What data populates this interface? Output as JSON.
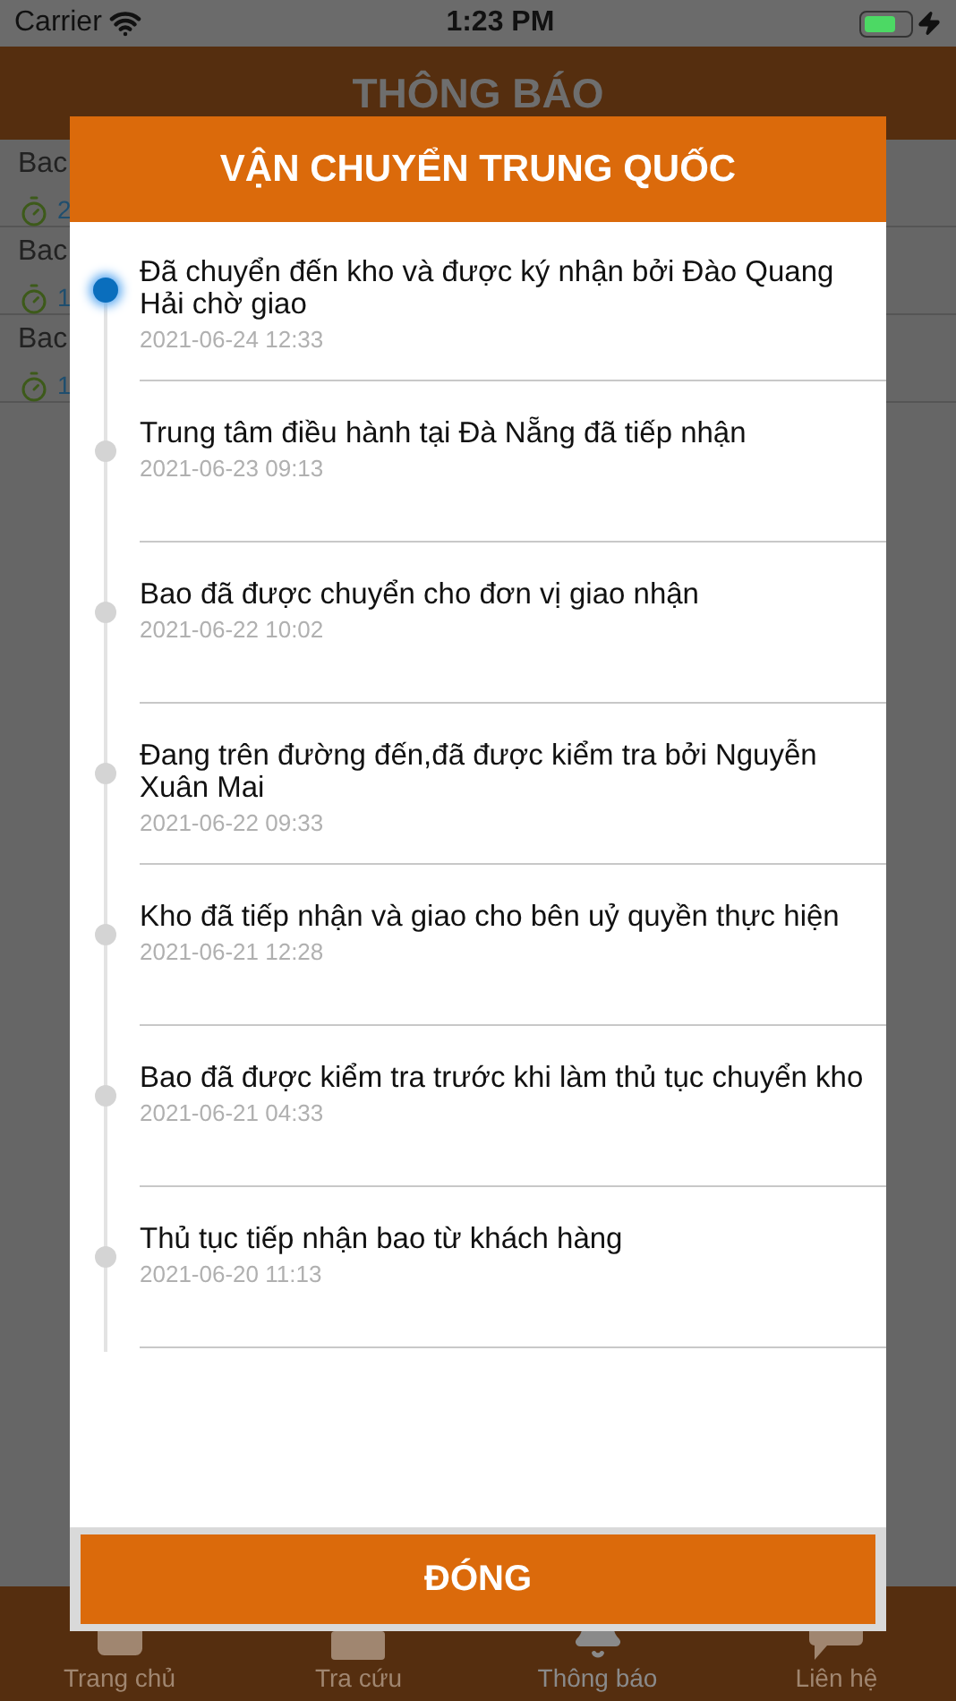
{
  "status_bar": {
    "carrier": "Carrier",
    "time": "1:23 PM"
  },
  "header": {
    "title": "THÔNG BÁO"
  },
  "notifications": [
    {
      "title": "Bac",
      "time": "2"
    },
    {
      "title": "Bac",
      "time": "1"
    },
    {
      "title": "Bac",
      "time": "1"
    }
  ],
  "tab_bar": [
    {
      "label": "Trang chủ",
      "selected": false
    },
    {
      "label": "Tra cứu",
      "selected": false
    },
    {
      "label": "Thông báo",
      "selected": true
    },
    {
      "label": "Liên hệ",
      "selected": false
    }
  ],
  "dialog": {
    "title": "VẬN CHUYỂN TRUNG QUỐC",
    "timeline": [
      {
        "text": "Đã chuyển đến kho và được ký nhận bởi Đào Quang Hải chờ giao",
        "time": "2021-06-24 12:33",
        "selected": true
      },
      {
        "text": "Trung tâm điều hành tại Đà Nẵng đã tiếp nhận",
        "time": "2021-06-23 09:13",
        "selected": false
      },
      {
        "text": "Bao đã được chuyển cho đơn vị giao nhận",
        "time": "2021-06-22 10:02",
        "selected": false
      },
      {
        "text": "Đang trên đường đến,đã được kiểm tra bởi Nguyễn Xuân Mai",
        "time": "2021-06-22 09:33",
        "selected": false
      },
      {
        "text": "Kho đã tiếp nhận và giao cho bên uỷ quyền thực hiện",
        "time": "2021-06-21 12:28",
        "selected": false
      },
      {
        "text": "Bao đã được kiểm tra trước khi làm thủ tục chuyển kho",
        "time": "2021-06-21 04:33",
        "selected": false
      },
      {
        "text": "Thủ tục tiếp nhận bao từ khách hàng",
        "time": "2021-06-20 11:13",
        "selected": false
      }
    ],
    "close_button": "ĐÓNG"
  }
}
